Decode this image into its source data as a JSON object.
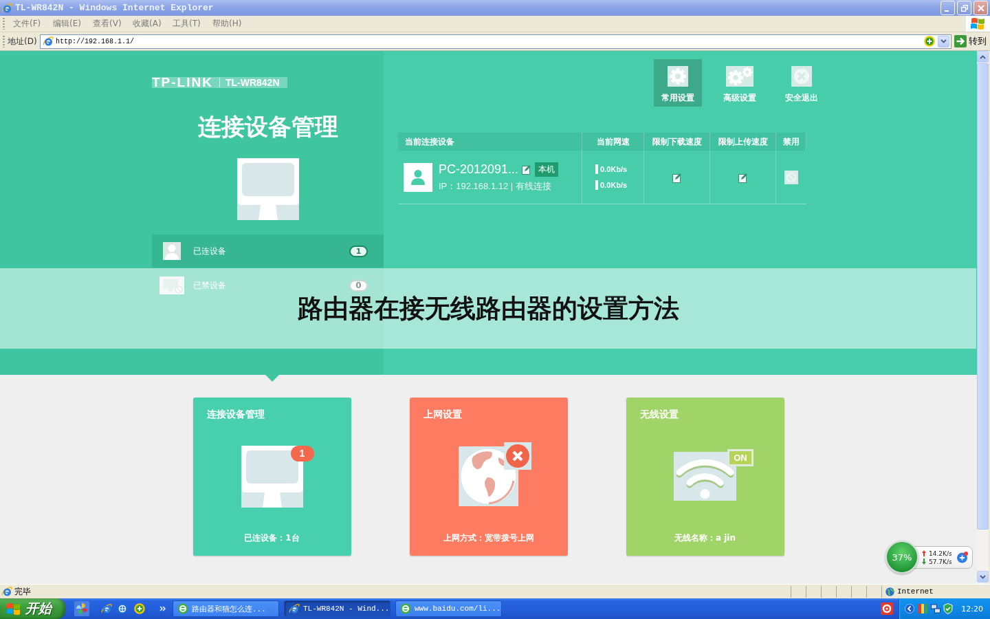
{
  "window": {
    "title": "TL-WR842N - Windows Internet Explorer"
  },
  "menu_bar": [
    "文件(F)",
    "编辑(E)",
    "查看(V)",
    "收藏(A)",
    "工具(T)",
    "帮助(H)"
  ],
  "address_bar": {
    "label": "地址(D)",
    "value": "http://192.168.1.1/",
    "go_button": "转到"
  },
  "router_page": {
    "logo": {
      "brand": "TP-LINK",
      "model": "TL-WR842N"
    },
    "heading": "连接设备管理",
    "sidebar": [
      {
        "label": "已连设备",
        "count": "1",
        "selected": true,
        "kind": "connected"
      },
      {
        "label": "已禁设备",
        "count": "0",
        "selected": false,
        "kind": "blocked"
      }
    ],
    "nav": [
      {
        "label": "常用设置",
        "kind": "gear",
        "selected": true
      },
      {
        "label": "高级设置",
        "kind": "gears",
        "selected": false
      },
      {
        "label": "安全退出",
        "kind": "exit",
        "selected": false
      }
    ],
    "table": {
      "columns": [
        "当前连接设备",
        "当前网速",
        "限制下载速度",
        "限制上传速度",
        "禁用"
      ],
      "rows": [
        {
          "name": "PC-2012091...",
          "tag": "本机",
          "address": "IP：192.168.1.12 | 有线连接",
          "speeds": [
            "0.0Kb/s",
            "0.0Kb/s"
          ],
          "blocked": false
        }
      ]
    },
    "cards": [
      {
        "kind": "devices",
        "title": "连接设备管理",
        "badge": "1",
        "caption": "已连设备：1台",
        "color": "#48cfad",
        "selected": true
      },
      {
        "kind": "internet",
        "title": "上网设置",
        "connected": false,
        "caption": "上网方式：宽带拨号上网",
        "color": "#fc7b61",
        "selected": false
      },
      {
        "kind": "wireless",
        "title": "无线设置",
        "badge": "ON",
        "caption": "无线名称：a jin",
        "color": "#a0d468",
        "selected": false
      }
    ]
  },
  "caption_banner": "路由器在接无线路由器的设置方法",
  "net_monitor": {
    "usage": "37%",
    "upload": "14.2K/s",
    "download": "57.7K/s"
  },
  "status_bar": {
    "text": "完毕",
    "zone": "Internet"
  },
  "taskbar": {
    "start": "开始",
    "tasks": [
      {
        "label": "路由器和猫怎么连...",
        "kind": "browser",
        "selected": false
      },
      {
        "label": "TL-WR842N - Wind...",
        "kind": "explorer",
        "selected": true
      },
      {
        "label": "www.baidu.com/li...",
        "kind": "browser",
        "selected": false
      }
    ],
    "clock": "12:20"
  }
}
